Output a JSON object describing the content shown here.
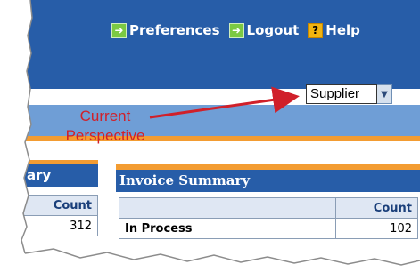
{
  "header": {
    "nav": [
      {
        "label": "Preferences",
        "icon": "arrow-right-icon"
      },
      {
        "label": "Logout",
        "icon": "arrow-right-icon"
      },
      {
        "label": "Help",
        "icon": "question-icon"
      }
    ]
  },
  "perspective_select": {
    "value": "Supplier"
  },
  "annotation": {
    "line1": "Current",
    "line2": "Perspective"
  },
  "left_panel": {
    "title": "ary",
    "column_header": "Count",
    "rows": [
      {
        "count": "312"
      }
    ]
  },
  "invoice_summary": {
    "title": "Invoice Summary",
    "column_header": "Count",
    "rows": [
      {
        "label": "In Process",
        "count": "102"
      }
    ]
  },
  "colors": {
    "header_blue": "#275da8",
    "light_band": "#6f9ed6",
    "orange_accent": "#f39c32",
    "annotation_red": "#d0202a",
    "icon_green": "#7bc943",
    "icon_yellow": "#f1b411"
  }
}
